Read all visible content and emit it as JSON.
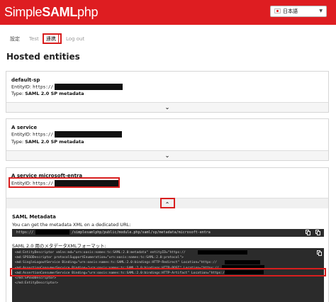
{
  "header": {
    "logo_prefix": "Simple",
    "logo_bold": "SAML",
    "logo_suffix": "php",
    "language": "日本語",
    "accent_color": "#de1d21"
  },
  "tabs": [
    {
      "label": "設定",
      "state": "normal"
    },
    {
      "label": "Test",
      "state": "muted"
    },
    {
      "label": "連携",
      "state": "active"
    },
    {
      "label": "Log out",
      "state": "muted"
    }
  ],
  "page_title": "Hosted entities",
  "entities": [
    {
      "name": "default-sp",
      "entity_label": "EntityID:",
      "entity_value": "https://",
      "type_label": "Type:",
      "type_value": "SAML 2.0 SP metadata",
      "toggle_icon": "chevron-down-icon"
    },
    {
      "name": "A service",
      "entity_label": "EntityID:",
      "entity_value": "https://",
      "type_label": "Type:",
      "type_value": "SAML 2.0 SP metadata",
      "toggle_icon": "chevron-down-icon"
    },
    {
      "name": "A service microsoft-entra",
      "entity_label": "EntityID:",
      "entity_value": "https://",
      "toggle_icon": "chevron-up-icon"
    }
  ],
  "metadata": {
    "title": "SAML Metadata",
    "description": "You can get the metadata XML on a dedicated URL:",
    "url_prefix": "https://",
    "url_suffix": "/simplesamlphp/public/module.php/saml/sp/metadata/microsoft-entra",
    "xml_label": "SAML 2.0 用のメタデータXMLフォーマット:",
    "xml_lines": [
      "<md:EntityDescriptor xmlns:md=\"urn:oasis:names:tc:SAML:2.0:metadata\" entityID=\"https://",
      "  <md:SPSSODescriptor protocolSupportEnumeration=\"urn:oasis:names:tc:SAML:2.0:protocol\">",
      "    <md:SingleLogoutService Binding=\"urn:oasis:names:tc:SAML:2.0:bindings:HTTP-Redirect\" Location=\"https://",
      "    <md:AssertionConsumerService Binding=\"urn:oasis:names:tc:SAML:2.0:bindings:HTTP-POST\" Location=\"https://",
      "    <md:AssertionConsumerService Binding=\"urn:oasis:names:tc:SAML:2.0:bindings:HTTP-Artifact\" Location=\"https://",
      "  </md:SPSSODescriptor>",
      "</md:EntityDescriptor>"
    ]
  }
}
